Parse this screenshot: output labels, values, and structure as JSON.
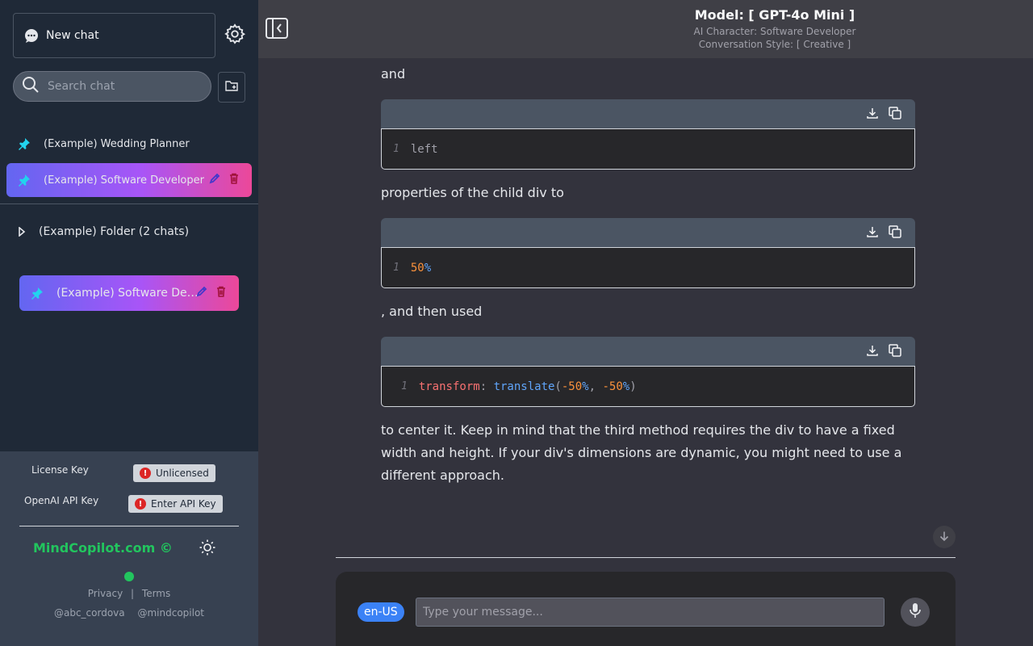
{
  "sidebar": {
    "new_chat_label": "New chat",
    "search_placeholder": "Search chat",
    "chats": [
      {
        "label": "(Example) Wedding Planner"
      },
      {
        "label": "(Example) Software Developer"
      }
    ],
    "folder": {
      "label": "(Example) Folder (2 chats)"
    },
    "folder_chat": {
      "label": "(Example) Software Developer"
    },
    "license_label": "License Key",
    "license_status": "Unlicensed",
    "api_label": "OpenAI API Key",
    "api_status": "Enter API Key",
    "error_glyph": "!",
    "brand": "MindCopilot.com ©",
    "privacy": "Privacy",
    "separator": "|",
    "terms": "Terms",
    "social_1": "@abc_cordova",
    "social_2": "@mindcopilot"
  },
  "header": {
    "title": "Model: [ GPT-4o Mini ]",
    "character": "AI Character: Software Developer",
    "style": "Conversation Style: [ Creative ]"
  },
  "conversation": {
    "text_1": "and",
    "code_1": {
      "line": "1",
      "text": "left"
    },
    "text_2": "properties of the child div to",
    "code_2": {
      "line": "1",
      "num": "50",
      "unit": "%"
    },
    "text_3": ", and then used",
    "code_3": {
      "line": "1",
      "prop": "transform",
      "colon": ":",
      "fn": "translate",
      "open": "(",
      "v1": "-50",
      "u1": "%",
      "comma": ",",
      "v2": "-50",
      "u2": "%",
      "close": ")"
    },
    "text_4": "to center it. Keep in mind that the third method requires the div to have a fixed width and height. If your div's dimensions are dynamic, you might need to use a different approach."
  },
  "composer": {
    "language": "en-US",
    "placeholder": "Type your message..."
  },
  "icons": {
    "new_chat": "chat-bubble-icon",
    "settings": "gear-icon",
    "search": "search-icon",
    "new_folder": "folder-plus-icon",
    "pin": "pin-icon",
    "edit": "pencil-icon",
    "delete": "trash-icon",
    "folder_expand": "caret-right-icon",
    "theme": "sun-icon",
    "sidebar_toggle": "sidebar-collapse-icon",
    "download": "download-icon",
    "copy": "copy-icon",
    "scroll_down": "arrow-down-icon",
    "mic": "microphone-icon"
  },
  "colors": {
    "accent_gradient_start": "#6366f1",
    "accent_gradient_end": "#ec4899",
    "brand_green": "#22c55e",
    "language_blue": "#3b82f6",
    "error_red": "#dc2626"
  }
}
